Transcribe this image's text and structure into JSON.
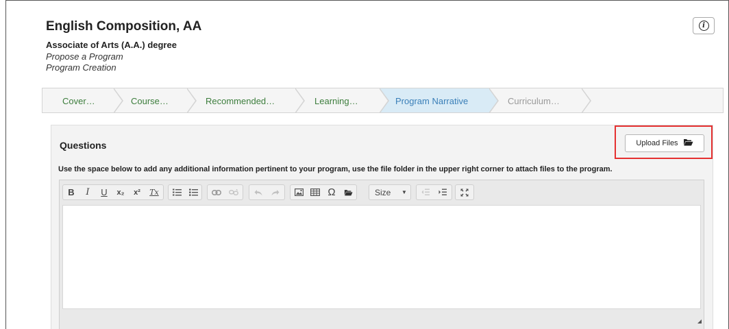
{
  "header": {
    "title": "English Composition, AA",
    "subtitle": "Associate of Arts (A.A.) degree",
    "breadcrumb_1": "Propose a Program",
    "breadcrumb_2": "Program Creation",
    "info_glyph": "i"
  },
  "steps": [
    {
      "label": "Cover…",
      "status": "done"
    },
    {
      "label": "Course…",
      "status": "done"
    },
    {
      "label": "Recommended…",
      "status": "done"
    },
    {
      "label": "Learning…",
      "status": "done"
    },
    {
      "label": "Program Narrative",
      "status": "active"
    },
    {
      "label": "Curriculum…",
      "status": "todo"
    }
  ],
  "panel": {
    "heading": "Questions",
    "upload_label": "Upload Files",
    "help_text": "Use the space below to add any additional information pertinent to your program, use the file folder in the upper right corner to attach files to the program."
  },
  "toolbar": {
    "bold": "B",
    "italic": "I",
    "underline": "U",
    "subscript": "x₂",
    "superscript": "x²",
    "remove_format": "Tx",
    "size_label": "Size"
  },
  "icons": {
    "info": "info-icon",
    "upload": "folder-open-icon",
    "resize": "resize-handle-icon"
  },
  "colors": {
    "active_step_bg": "#d9ebf6",
    "active_step_text": "#3a7fb8",
    "done_step_text": "#3c7d3c",
    "todo_step_text": "#9a9a9a",
    "highlight_border": "#e53030"
  }
}
